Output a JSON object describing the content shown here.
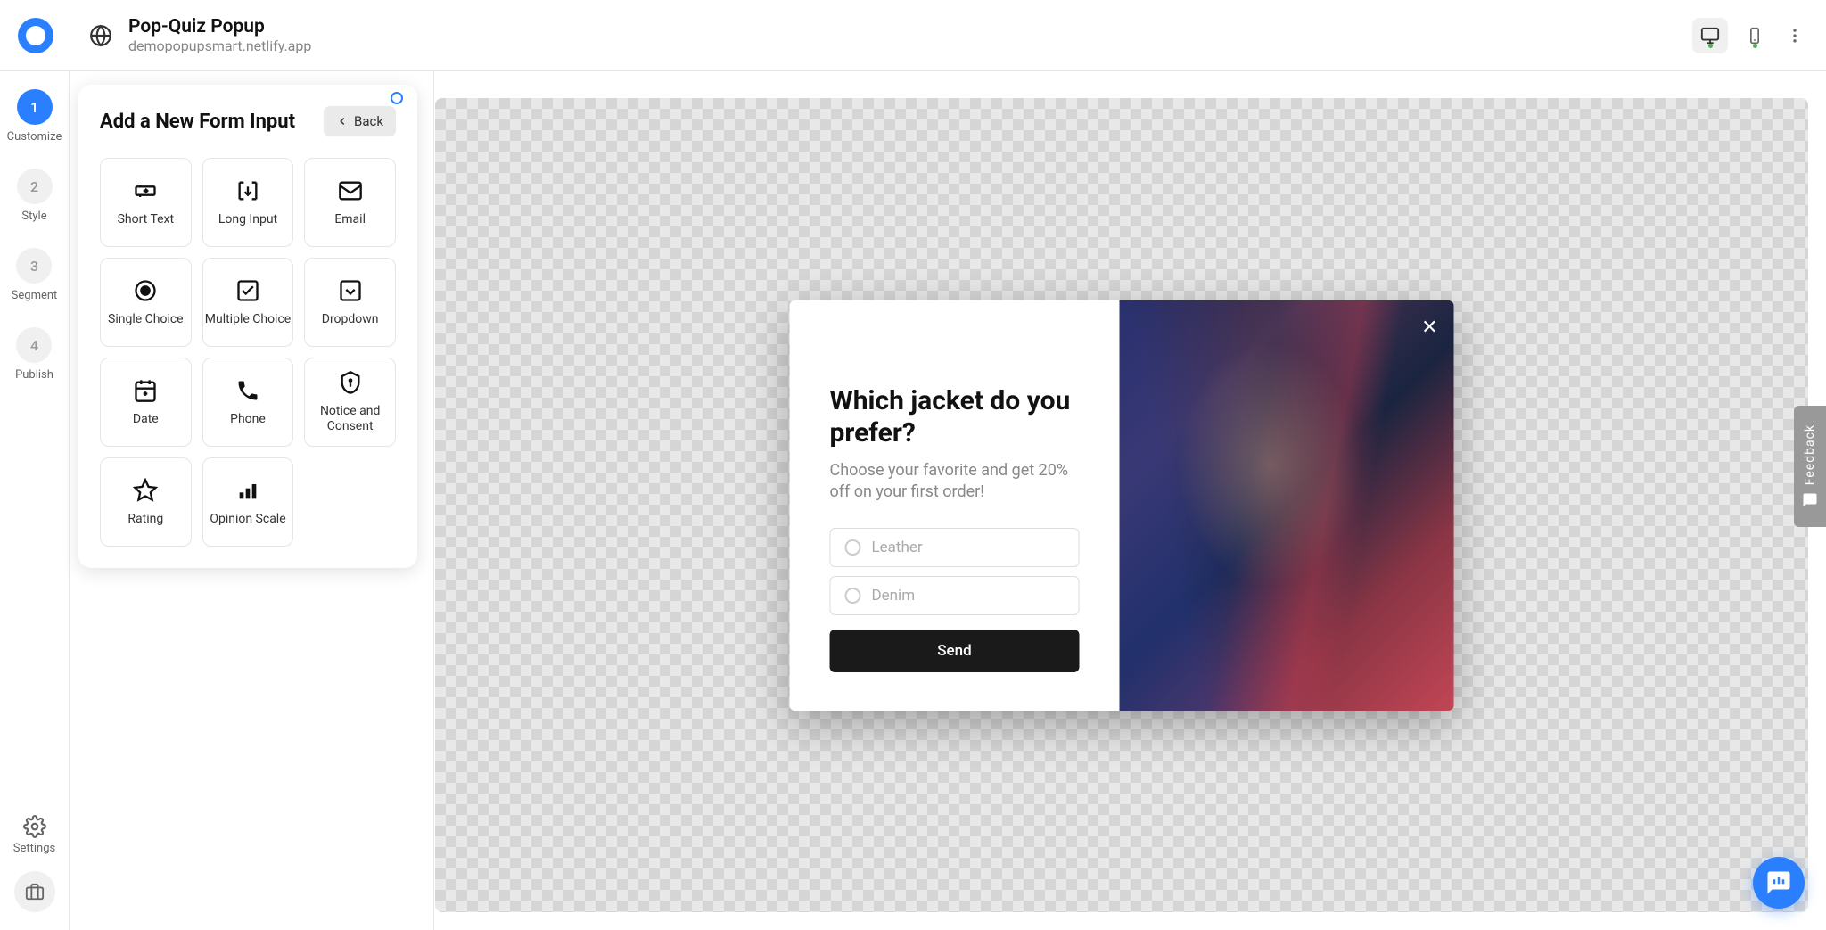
{
  "header": {
    "title": "Pop-Quiz Popup",
    "subtitle": "demopopupsmart.netlify.app"
  },
  "steps": [
    {
      "num": "1",
      "label": "Customize",
      "active": true
    },
    {
      "num": "2",
      "label": "Style",
      "active": false
    },
    {
      "num": "3",
      "label": "Segment",
      "active": false
    },
    {
      "num": "4",
      "label": "Publish",
      "active": false
    }
  ],
  "sidebar": {
    "settings": "Settings"
  },
  "panel": {
    "title": "Add a New Form Input",
    "back": "Back",
    "inputs": [
      "Short Text",
      "Long Input",
      "Email",
      "Single Choice",
      "Multiple Choice",
      "Dropdown",
      "Date",
      "Phone",
      "Notice and Consent",
      "Rating",
      "Opinion Scale"
    ]
  },
  "popup": {
    "title": "Which jacket do you prefer?",
    "subtitle": "Choose your favorite and get 20% off on your first order!",
    "options": [
      "Leather",
      "Denim"
    ],
    "button": "Send"
  },
  "feedback": "Feedback"
}
